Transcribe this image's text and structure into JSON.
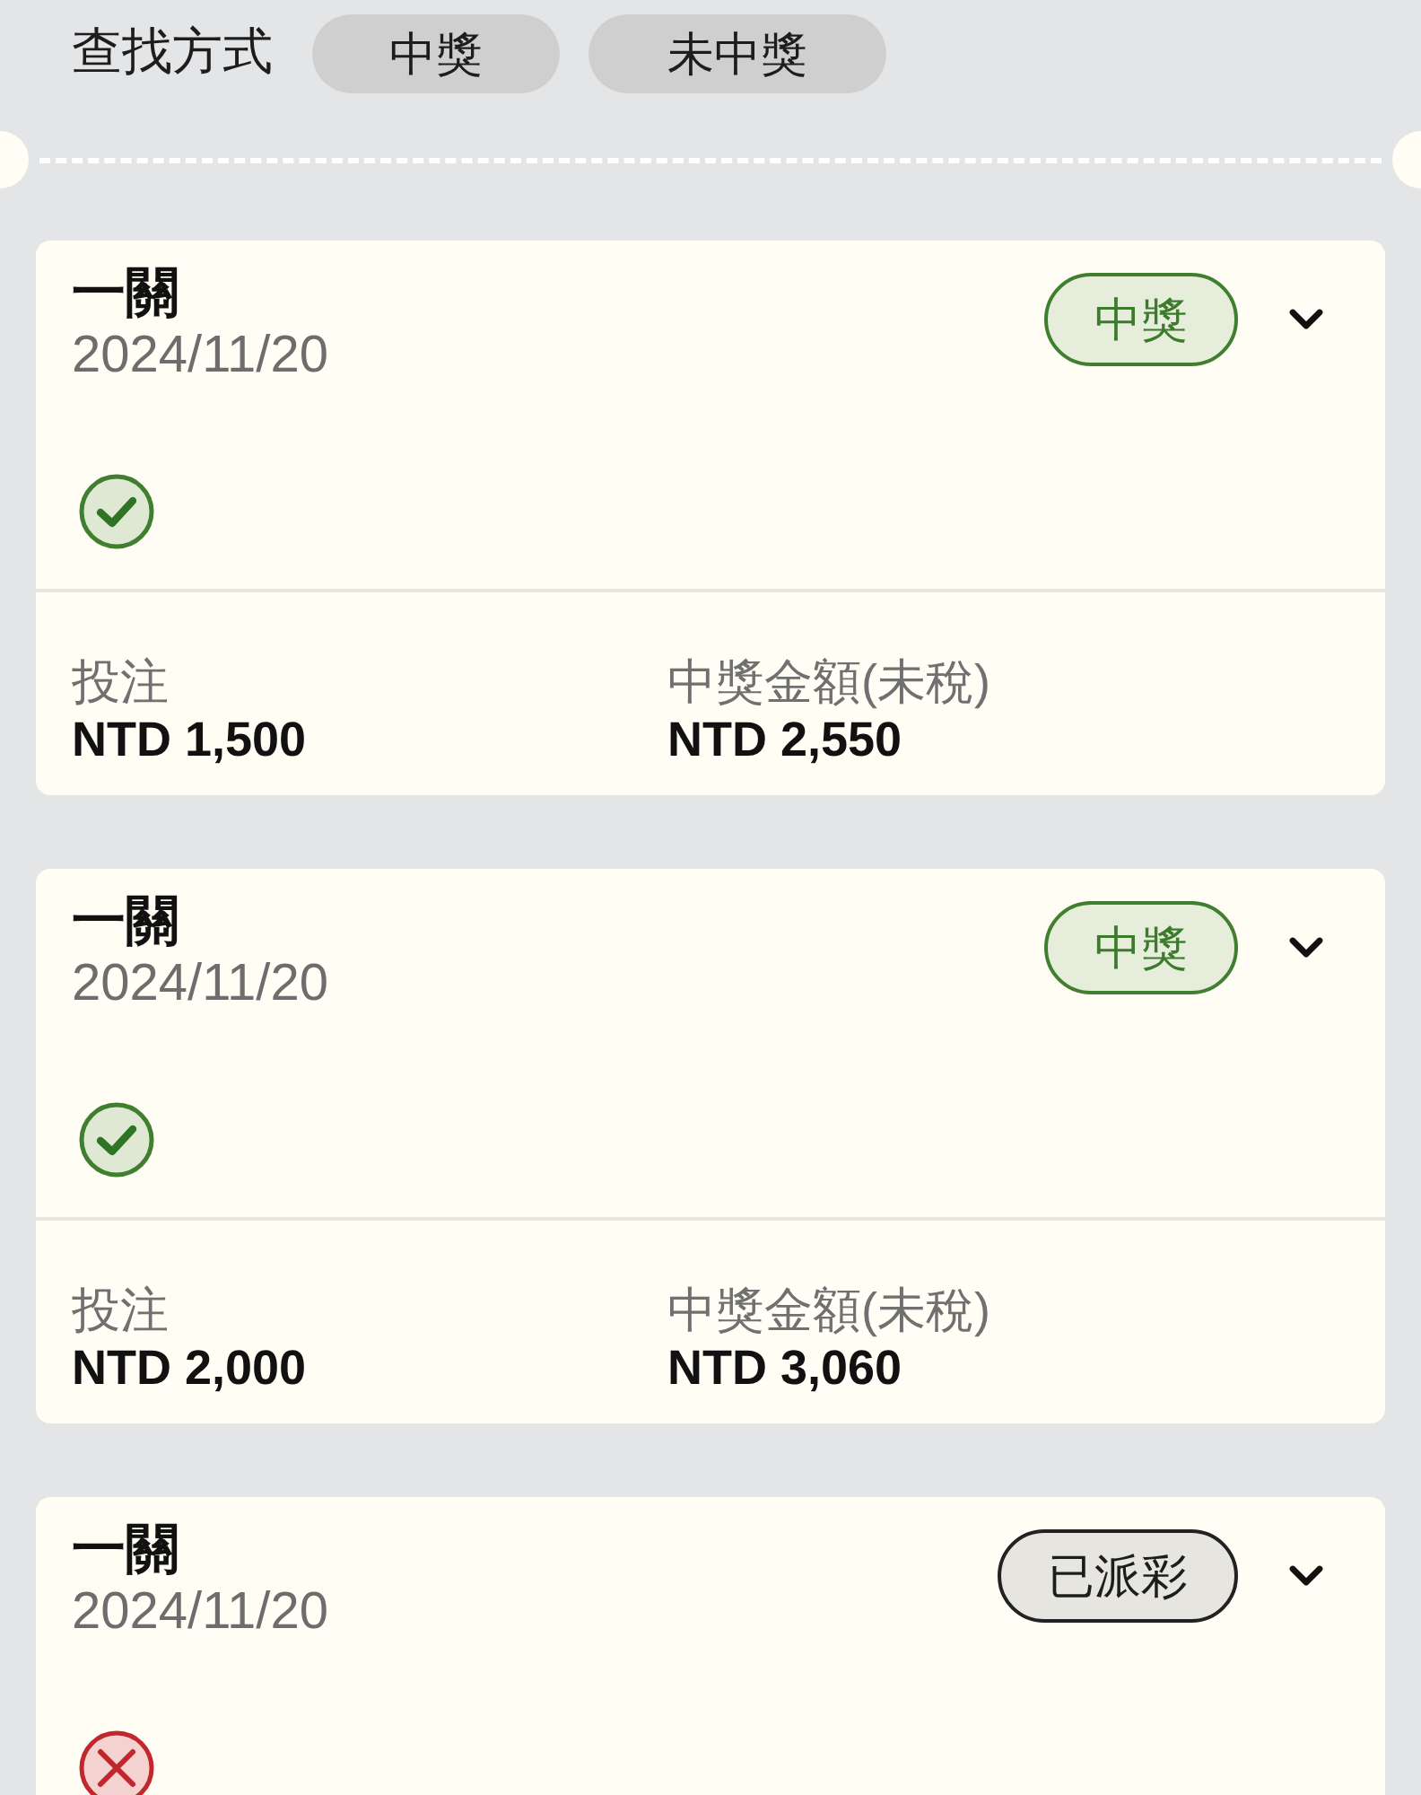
{
  "filter": {
    "label": "查找方式",
    "options": [
      {
        "label": "中獎",
        "selected": false
      },
      {
        "label": "未中獎",
        "selected": false
      }
    ]
  },
  "tickets": [
    {
      "title": "一關",
      "date": "2024/11/20",
      "status": {
        "kind": "won",
        "label": "中獎"
      },
      "result": {
        "kind": "win"
      },
      "stake_label": "投注",
      "stake": "NTD 1,500",
      "payout_label": "中獎金額(未稅)",
      "payout": "NTD 2,550"
    },
    {
      "title": "一關",
      "date": "2024/11/20",
      "status": {
        "kind": "won",
        "label": "中獎"
      },
      "result": {
        "kind": "win"
      },
      "stake_label": "投注",
      "stake": "NTD 2,000",
      "payout_label": "中獎金額(未稅)",
      "payout": "NTD 3,060"
    },
    {
      "title": "一關",
      "date": "2024/11/20",
      "status": {
        "kind": "paid",
        "label": "已派彩"
      },
      "result": {
        "kind": "lose"
      }
    }
  ]
}
